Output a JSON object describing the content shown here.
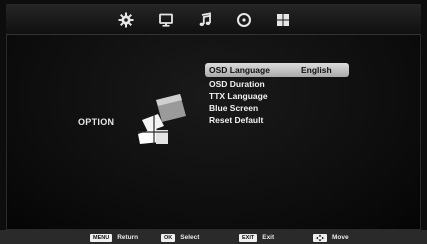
{
  "top_tabs": [
    {
      "icon": "gear-icon"
    },
    {
      "icon": "monitor-icon"
    },
    {
      "icon": "music-note-icon"
    },
    {
      "icon": "clock-icon"
    },
    {
      "icon": "grid-icon"
    }
  ],
  "section_label": "OPTION",
  "menu": {
    "items": [
      {
        "label": "OSD Language",
        "value": "English",
        "selected": true
      },
      {
        "label": "OSD Duration"
      },
      {
        "label": "TTX Language"
      },
      {
        "label": "Blue Screen"
      },
      {
        "label": "Reset Default"
      }
    ]
  },
  "footer": {
    "menu_key": "MENU",
    "menu_text": "Return",
    "ok_key": "OK",
    "ok_text": "Select",
    "exit_key": "EXIT",
    "exit_text": "Exit",
    "move_key_icon": "dpad-icon",
    "move_text": "Move"
  },
  "colors": {
    "background": "#0d0d0d",
    "highlight": "#c8c8c8",
    "text": "#f2f2f2"
  }
}
